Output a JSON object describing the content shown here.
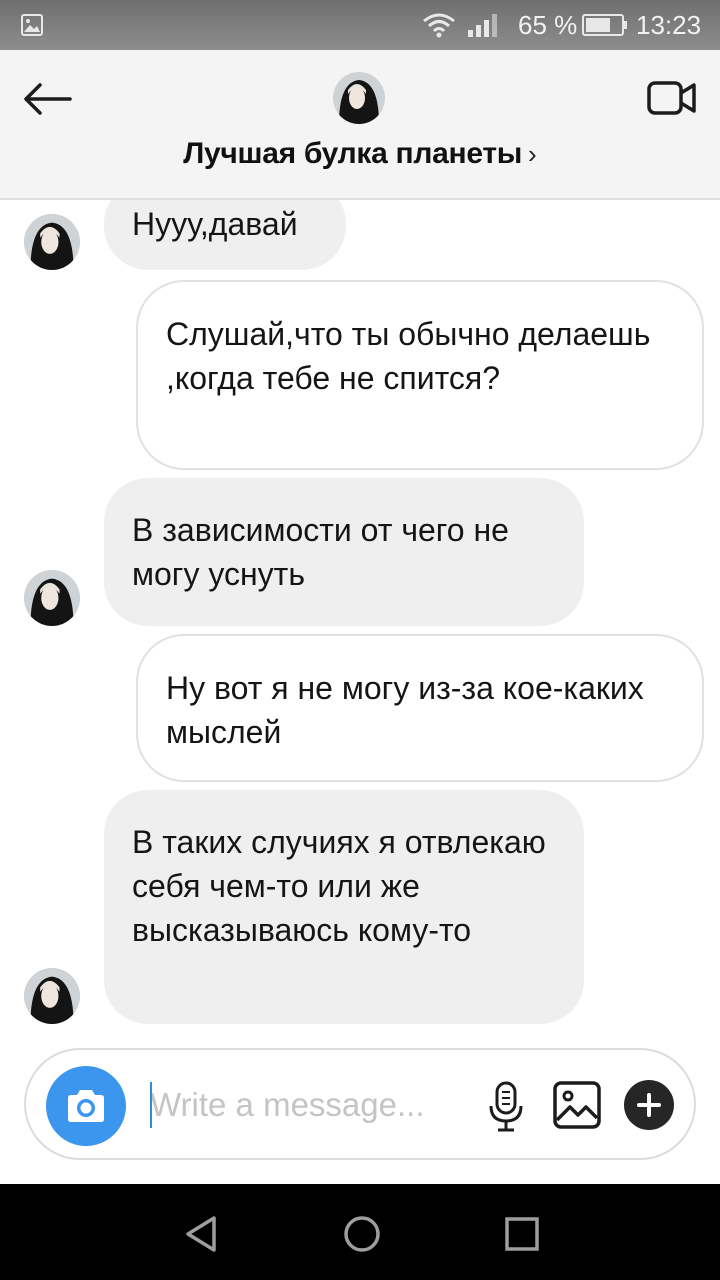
{
  "status_bar": {
    "battery": "65 %",
    "time": "13:23",
    "icons": [
      "gallery-icon",
      "wifi-icon",
      "signal-icon",
      "battery-icon"
    ]
  },
  "header": {
    "title": "Лучшая булка планеты",
    "chevron": "›",
    "icons": [
      "back-arrow-icon",
      "avatar",
      "video-camera-icon"
    ]
  },
  "messages": [
    {
      "side": "in",
      "text": "Нууу,давай"
    },
    {
      "side": "out",
      "text": "Слушай,что ты обычно делаешь ,когда тебе не спится?"
    },
    {
      "side": "in",
      "text": "В зависимости от чего не могу уснуть"
    },
    {
      "side": "out",
      "text": "Ну вот я не могу из-за кое-каких мыслей"
    },
    {
      "side": "in",
      "text": "В таких случиях я отвлекаю себя чем-то или же высказываюсь кому-то"
    }
  ],
  "composer": {
    "placeholder": "Write a message...",
    "icons": [
      "camera-icon",
      "microphone-icon",
      "image-icon",
      "plus-icon"
    ]
  },
  "colors": {
    "accent": "#3d96ed",
    "incoming_bubble": "#efefef",
    "outgoing_bubble_border": "#e1e1e1"
  },
  "nav_bar": {
    "icons": [
      "nav-back-icon",
      "nav-home-icon",
      "nav-recents-icon"
    ]
  }
}
